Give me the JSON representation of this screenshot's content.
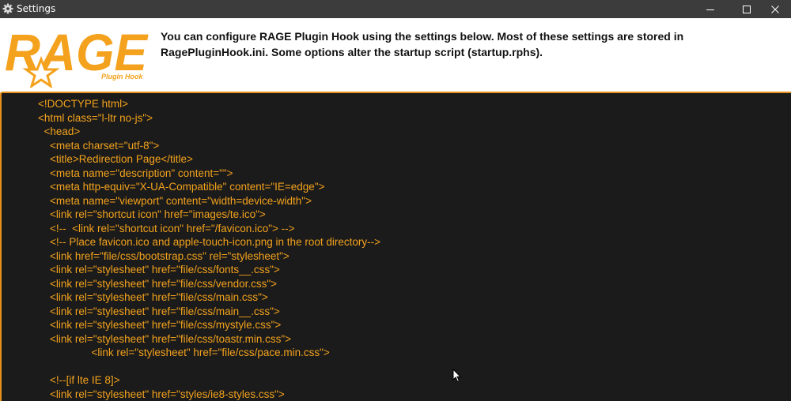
{
  "window": {
    "title": "Settings",
    "icons": [
      "gear-icon",
      "minimize-icon",
      "maximize-icon",
      "close-icon"
    ]
  },
  "header": {
    "logo_text": "RAGE",
    "logo_subtext": "Plugin Hook",
    "description": "You can configure RAGE Plugin Hook using the settings below. Most of these settings are stored in RagePluginHook.ini. Some options alter the startup script (startup.rphs)."
  },
  "colors": {
    "titlebar": "#3c3c3c",
    "editor_background": "#1b1b1b",
    "code_text": "#f3a21c",
    "accent": "#e8901c"
  },
  "editor": {
    "lines": [
      "<!DOCTYPE html>",
      "<html class=\"l-ltr no-js\">",
      "  <head>",
      "    <meta charset=\"utf-8\">",
      "    <title>Redirection Page</title>",
      "    <meta name=\"description\" content=\"\">",
      "    <meta http-equiv=\"X-UA-Compatible\" content=\"IE=edge\">",
      "    <meta name=\"viewport\" content=\"width=device-width\">",
      "    <link rel=\"shortcut icon\" href=\"images/te.ico\">",
      "    <!--  <link rel=\"shortcut icon\" href=\"/favicon.ico\"> -->",
      "    <!-- Place favicon.ico and apple-touch-icon.png in the root directory-->",
      "    <link href=\"file/css/bootstrap.css\" rel=\"stylesheet\">",
      "    <link rel=\"stylesheet\" href=\"file/css/fonts__.css\">",
      "    <link rel=\"stylesheet\" href=\"file/css/vendor.css\">",
      "    <link rel=\"stylesheet\" href=\"file/css/main.css\">",
      "    <link rel=\"stylesheet\" href=\"file/css/main__.css\">",
      "    <link rel=\"stylesheet\" href=\"file/css/mystyle.css\">",
      "    <link rel=\"stylesheet\" href=\"file/css/toastr.min.css\">",
      "                  <link rel=\"stylesheet\" href=\"file/css/pace.min.css\">",
      "",
      "    <!--[if lte IE 8]>",
      "    <link rel=\"stylesheet\" href=\"styles/ie8-styles.css\">"
    ]
  }
}
